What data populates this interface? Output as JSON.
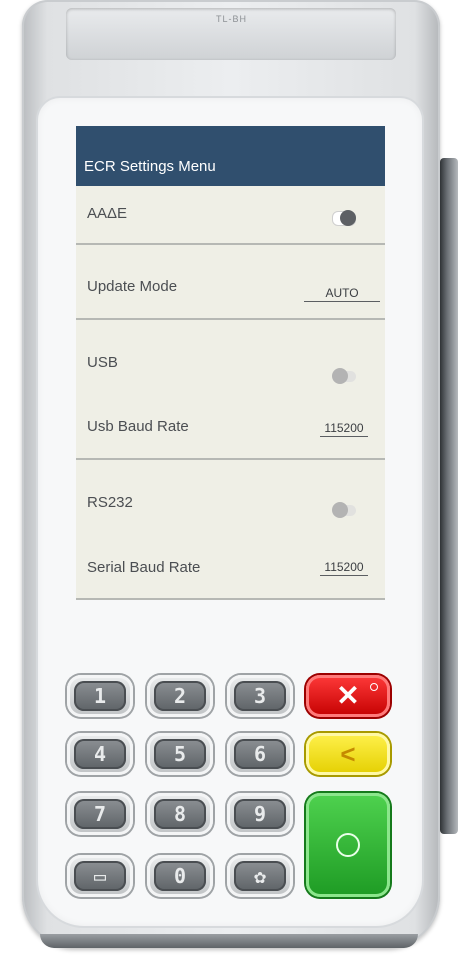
{
  "device": {
    "printer_logo": "TL-BH"
  },
  "screen": {
    "title": "ECR Settings Menu",
    "rows": {
      "aade": {
        "label": "ΑΑΔΕ",
        "toggle": "on"
      },
      "update_mode": {
        "label": "Update Mode",
        "value": "AUTO"
      },
      "usb": {
        "label": "USB",
        "toggle": "off"
      },
      "usb_baud": {
        "label": "Usb Baud Rate",
        "value": "115200"
      },
      "rs232": {
        "label": "RS232",
        "toggle": "off"
      },
      "serial_baud": {
        "label": "Serial Baud Rate",
        "value": "115200"
      }
    }
  },
  "keypad": {
    "keys": [
      "1",
      "2",
      "3",
      "4",
      "5",
      "6",
      "7",
      "8",
      "9",
      "▭",
      "0",
      "✿"
    ],
    "cancel_label": "✕",
    "clear_label": "<",
    "enter_icon": "confirm-circle-icon",
    "colors": {
      "cancel": "#ff2020",
      "clear": "#f5e600",
      "enter": "#2cb533"
    }
  }
}
